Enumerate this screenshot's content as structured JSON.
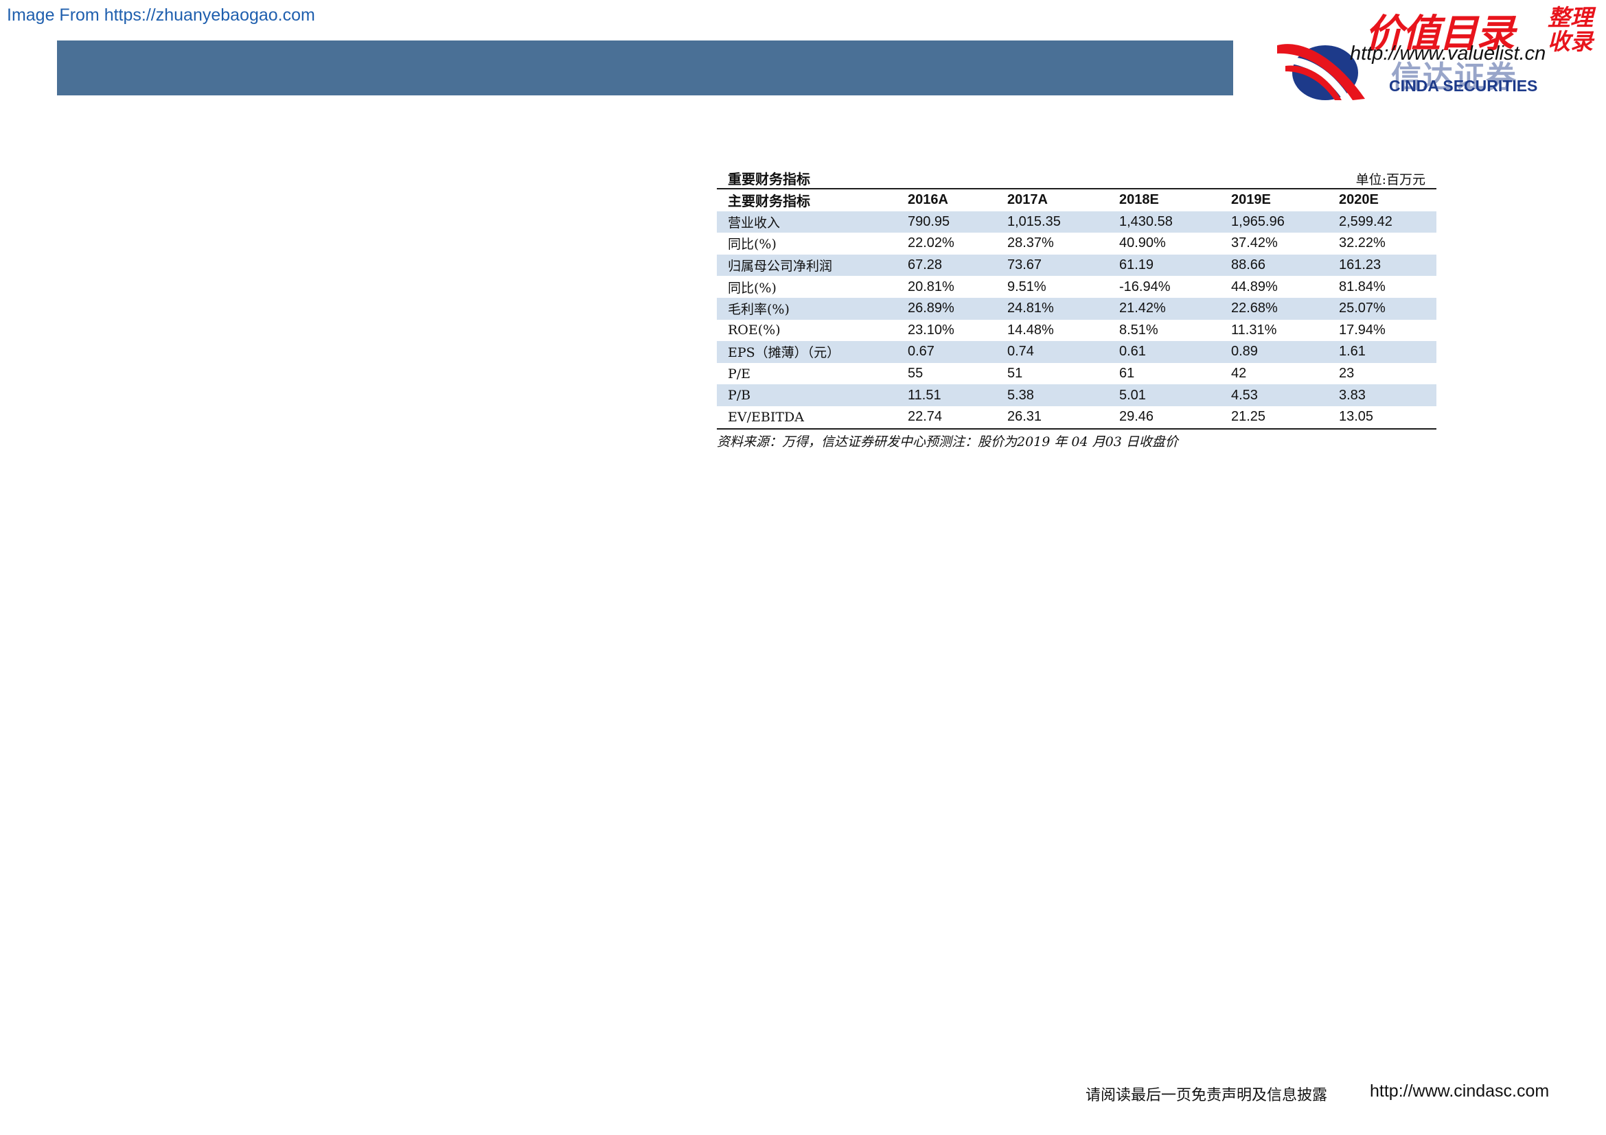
{
  "source_link": "Image From https://zhuanyebaogao.com",
  "logo": {
    "watermark_main": "价值目录",
    "watermark_side": "整理收录",
    "watermark_url": "http://www.valuelist.cn",
    "company_cn": "信达证券",
    "company_en": "CINDA SECURITIES"
  },
  "table": {
    "title": "重要财务指标",
    "unit": "单位:百万元",
    "headers": [
      "主要财务指标",
      "2016A",
      "2017A",
      "2018E",
      "2019E",
      "2020E"
    ],
    "rows": [
      [
        "营业收入",
        "790.95",
        "1,015.35",
        "1,430.58",
        "1,965.96",
        "2,599.42"
      ],
      [
        "同比(%)",
        "22.02%",
        "28.37%",
        "40.90%",
        "37.42%",
        "32.22%"
      ],
      [
        "归属母公司净利润",
        "67.28",
        "73.67",
        "61.19",
        "88.66",
        "161.23"
      ],
      [
        "同比(%)",
        "20.81%",
        "9.51%",
        "-16.94%",
        "44.89%",
        "81.84%"
      ],
      [
        "毛利率(%)",
        "26.89%",
        "24.81%",
        "21.42%",
        "22.68%",
        "25.07%"
      ],
      [
        "ROE(%)",
        "23.10%",
        "14.48%",
        "8.51%",
        "11.31%",
        "17.94%"
      ],
      [
        "EPS（摊薄）（元）",
        "0.67",
        "0.74",
        "0.61",
        "0.89",
        "1.61"
      ],
      [
        "P/E",
        "55",
        "51",
        "61",
        "42",
        "23"
      ],
      [
        "P/B",
        "11.51",
        "5.38",
        "5.01",
        "4.53",
        "3.83"
      ],
      [
        "EV/EBITDA",
        "22.74",
        "26.31",
        "29.46",
        "21.25",
        "13.05"
      ]
    ],
    "note": "资料来源：万得，信达证券研发中心预测注：股价为2019 年 04 月03 日收盘价"
  },
  "footer": {
    "disclaimer": "请阅读最后一页免责声明及信息披露",
    "url": "http://www.cindasc.com"
  },
  "colors": {
    "header_bar": "#4a7096",
    "row_stripe": "#d3e0ee",
    "watermark_red": "#e8141c",
    "logo_blue": "#1d3a8a"
  }
}
